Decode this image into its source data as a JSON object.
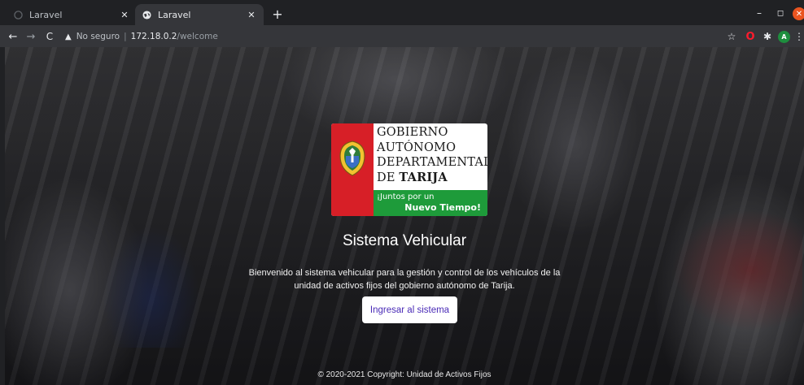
{
  "browser": {
    "tabs": [
      {
        "title": "Laravel",
        "state": "inactive"
      },
      {
        "title": "Laravel",
        "state": "active"
      }
    ],
    "new_tab_icon": "plus-icon",
    "address": {
      "security_label": "No seguro",
      "host": "172.18.0.2",
      "path": "/welcome"
    }
  },
  "logo": {
    "line1": "GOBIERNO",
    "line2": "AUTÓNOMO",
    "line3": "DEPARTAMENTAL",
    "line4_prefix": "DE ",
    "line4_strong": "TARIJA",
    "slogan_line1": "¡Juntos por un",
    "slogan_line2": "Nuevo Tiempo!",
    "colors": {
      "red": "#d71f27",
      "green": "#1e9b3a"
    }
  },
  "hero": {
    "title": "Sistema Vehicular",
    "description_line1": "Bienvenido al sistema vehicular para la gestión y control de los vehículos de la",
    "description_line2": "unidad de activos fijos del gobierno autónomo de Tarija.",
    "button_label": "Ingresar al sistema",
    "button_color": "#4a2bb7"
  },
  "footer": {
    "copyright": "© 2020-2021 Copyright: Unidad de Activos Fijos"
  }
}
